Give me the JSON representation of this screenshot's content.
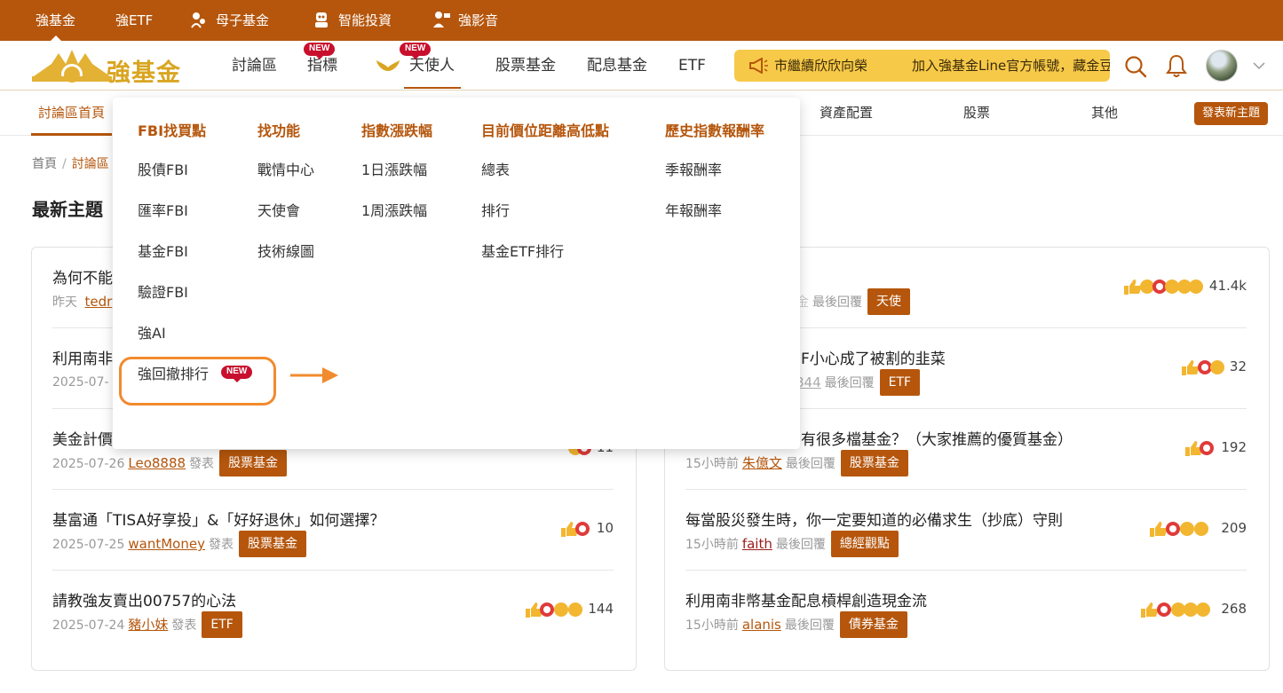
{
  "topbar": {
    "items": [
      "強基金",
      "強ETF",
      "母子基金",
      "智能投資",
      "強影音"
    ],
    "icons": [
      "",
      "",
      "fund-family-icon",
      "robo-advisor-icon",
      "video-icon"
    ]
  },
  "header": {
    "logo_text": "強基金",
    "nav": [
      {
        "label": "討論區",
        "badge": ""
      },
      {
        "label": "指標",
        "badge": "NEW"
      },
      {
        "label": "天使人",
        "badge": "NEW"
      },
      {
        "label": "股票基金",
        "badge": ""
      },
      {
        "label": "配息基金",
        "badge": ""
      },
      {
        "label": "ETF",
        "badge": ""
      }
    ],
    "marquee": [
      "市繼續欣欣向榮",
      "加入強基金Line官方帳號，藏金豆"
    ],
    "accent": "#b5560c",
    "marquee_bg": "#f7c948"
  },
  "subnav": {
    "items": [
      "討論區首頁",
      "資產配置",
      "股票",
      "其他"
    ],
    "post_button": "發表新主題"
  },
  "breadcrumb": {
    "home": "首頁",
    "sep": "/",
    "current": "討論區"
  },
  "page_heading": "最新主題",
  "dropdown": {
    "columns": [
      {
        "head": "FBI找買點",
        "items": [
          "股債FBI",
          "匯率FBI",
          "基金FBI",
          "驗證FBI",
          "強AI",
          "強回撤排行"
        ]
      },
      {
        "head": "找功能",
        "items": [
          "戰情中心",
          "天使會",
          "技術線圖"
        ]
      },
      {
        "head": "指數漲跌幅",
        "items": [
          "1日漲跌幅",
          "1周漲跌幅"
        ]
      },
      {
        "head": "目前價位距離高低點",
        "items": [
          "總表",
          "排行",
          "基金ETF排行"
        ]
      },
      {
        "head": "歷史指數報酬率",
        "items": [
          "季報酬率",
          "年報酬率"
        ]
      }
    ],
    "new_badge": "NEW"
  },
  "posts_left": [
    {
      "title": "為何不能",
      "date": "昨天",
      "author": "tedr",
      "action": "",
      "tag": "",
      "count": ""
    },
    {
      "title": "利用南非",
      "date": "2025-07-",
      "author": "",
      "action": "",
      "tag": "",
      "count": ""
    },
    {
      "title": "美金計價",
      "date": "2025-07-26",
      "author": "Leo8888",
      "action": "發表",
      "tag": "股票基金",
      "count": "11"
    },
    {
      "title": "基富通「TISA好享投」&「好好退休」如何選擇？",
      "date": "2025-07-25",
      "author": "wantMoney",
      "action": "發表",
      "tag": "股票基金",
      "count": "10"
    },
    {
      "title": "請教強友賣出00757的心法",
      "date": "2025-07-24",
      "author": "豬小妹",
      "action": "發表",
      "tag": "ETF",
      "count": "144"
    }
  ],
  "posts_right": [
    {
      "title": "",
      "date": "",
      "author": "金",
      "action": "最後回覆",
      "tag": "天使",
      "count": "41.4k"
    },
    {
      "title": "F小心成了被割的韭菜",
      "date": "",
      "author": "844",
      "action": "最後回覆",
      "tag": "ETF",
      "count": "32"
    },
    {
      "title": "有很多檔基金？（大家推薦的優質基金）",
      "date": "15小時前",
      "author": "朱億文",
      "action": "最後回覆",
      "tag": "股票基金",
      "count": "192"
    },
    {
      "title": "每當股災發生時，你一定要知道的必備求生（抄底）守則",
      "date": "15小時前",
      "author": "faith",
      "action": "最後回覆",
      "tag": "總經觀點",
      "count": "209"
    },
    {
      "title": "利用南非幣基金配息槓桿創造現金流",
      "date": "15小時前",
      "author": "alanis",
      "action": "最後回覆",
      "tag": "債券基金",
      "count": "268"
    }
  ]
}
